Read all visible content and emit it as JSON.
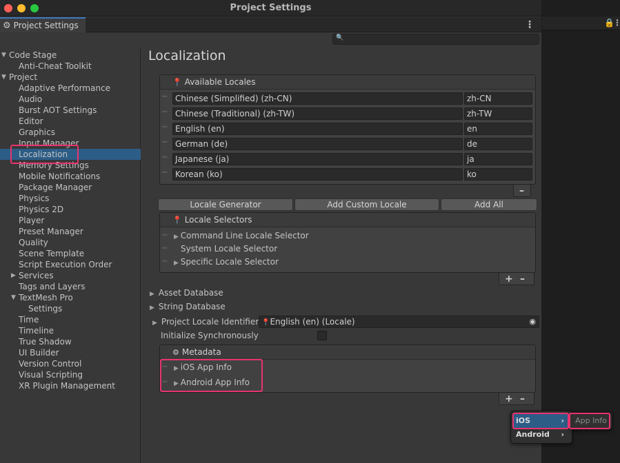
{
  "window": {
    "title": "Project Settings",
    "tab_label": "Project Settings"
  },
  "sidebar": {
    "items": [
      {
        "label": "Code Stage",
        "indent": 0,
        "arrow": "▼"
      },
      {
        "label": "Anti-Cheat Toolkit",
        "indent": 1,
        "arrow": ""
      },
      {
        "label": "Project",
        "indent": 0,
        "arrow": "▼"
      },
      {
        "label": "Adaptive Performance",
        "indent": 1,
        "arrow": ""
      },
      {
        "label": "Audio",
        "indent": 1,
        "arrow": ""
      },
      {
        "label": "Burst AOT Settings",
        "indent": 1,
        "arrow": ""
      },
      {
        "label": "Editor",
        "indent": 1,
        "arrow": ""
      },
      {
        "label": "Graphics",
        "indent": 1,
        "arrow": ""
      },
      {
        "label": "Input Manager",
        "indent": 1,
        "arrow": ""
      },
      {
        "label": "Localization",
        "indent": 1,
        "arrow": "",
        "selected": true
      },
      {
        "label": "Memory Settings",
        "indent": 1,
        "arrow": ""
      },
      {
        "label": "Mobile Notifications",
        "indent": 1,
        "arrow": ""
      },
      {
        "label": "Package Manager",
        "indent": 1,
        "arrow": ""
      },
      {
        "label": "Physics",
        "indent": 1,
        "arrow": ""
      },
      {
        "label": "Physics 2D",
        "indent": 1,
        "arrow": ""
      },
      {
        "label": "Player",
        "indent": 1,
        "arrow": ""
      },
      {
        "label": "Preset Manager",
        "indent": 1,
        "arrow": ""
      },
      {
        "label": "Quality",
        "indent": 1,
        "arrow": ""
      },
      {
        "label": "Scene Template",
        "indent": 1,
        "arrow": ""
      },
      {
        "label": "Script Execution Order",
        "indent": 1,
        "arrow": ""
      },
      {
        "label": "Services",
        "indent": 0,
        "arrow": "▶",
        "arrow_indent": 1
      },
      {
        "label": "Tags and Layers",
        "indent": 1,
        "arrow": ""
      },
      {
        "label": "TextMesh Pro",
        "indent": 0,
        "arrow": "▼",
        "arrow_indent": 1
      },
      {
        "label": "Settings",
        "indent": 2,
        "arrow": ""
      },
      {
        "label": "Time",
        "indent": 1,
        "arrow": ""
      },
      {
        "label": "Timeline",
        "indent": 1,
        "arrow": ""
      },
      {
        "label": "True Shadow",
        "indent": 1,
        "arrow": ""
      },
      {
        "label": "UI Builder",
        "indent": 1,
        "arrow": ""
      },
      {
        "label": "Version Control",
        "indent": 1,
        "arrow": ""
      },
      {
        "label": "Visual Scripting",
        "indent": 1,
        "arrow": ""
      },
      {
        "label": "XR Plugin Management",
        "indent": 1,
        "arrow": ""
      }
    ]
  },
  "main": {
    "title": "Localization",
    "available_locales": {
      "header": "Available Locales",
      "rows": [
        {
          "name": "Chinese (Simplified) (zh-CN)",
          "code": "zh-CN"
        },
        {
          "name": "Chinese (Traditional) (zh-TW)",
          "code": "zh-TW"
        },
        {
          "name": "English (en)",
          "code": "en"
        },
        {
          "name": "German (de)",
          "code": "de"
        },
        {
          "name": "Japanese (ja)",
          "code": "ja"
        },
        {
          "name": "Korean (ko)",
          "code": "ko"
        }
      ],
      "minus": "–"
    },
    "buttons": {
      "locale_generator": "Locale Generator",
      "add_custom_locale": "Add Custom Locale",
      "add_all": "Add All"
    },
    "locale_selectors": {
      "header": "Locale Selectors",
      "items": [
        {
          "label": "Command Line Locale Selector",
          "expandable": true
        },
        {
          "label": "System Locale Selector",
          "expandable": false
        },
        {
          "label": "Specific Locale Selector",
          "expandable": true
        }
      ],
      "plus": "+",
      "minus": "–"
    },
    "asset_database": "Asset Database",
    "string_database": "String Database",
    "project_locale_identifier": {
      "label": "Project Locale Identifier",
      "value": "English (en) (Locale)"
    },
    "initialize_synchronously": {
      "label": "Initialize Synchronously",
      "checked": false
    },
    "metadata": {
      "header": "Metadata",
      "items": [
        "iOS App Info",
        "Android App Info"
      ],
      "plus": "+",
      "minus": "–"
    }
  },
  "popup_menu": {
    "items": [
      {
        "label": "iOS",
        "selected": true
      },
      {
        "label": "Android",
        "selected": false
      }
    ],
    "submenu_item": "App Info"
  },
  "colors": {
    "selection": "#2c5d87",
    "highlight": "#e8346e",
    "accent": "#3a79bb"
  }
}
